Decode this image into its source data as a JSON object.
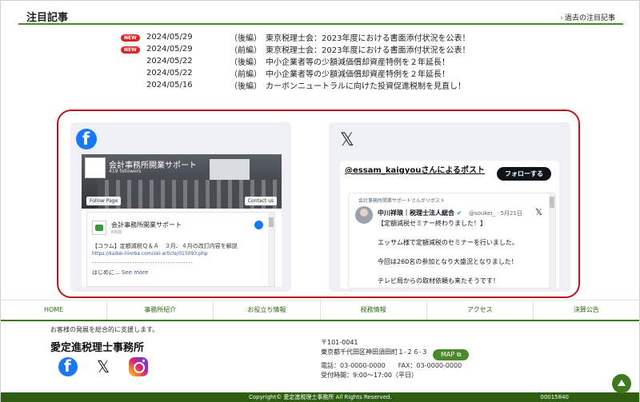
{
  "news": {
    "title": "注目記事",
    "past_link": "過去の注目記事",
    "badge_label": "NEW",
    "items": [
      {
        "new": true,
        "date": "2024/05/29",
        "text": "（後編）　東京税理士会：2023年度における書面添付状況を公表！"
      },
      {
        "new": true,
        "date": "2024/05/29",
        "text": "（前編）　東京税理士会：2023年度における書面添付状況を公表！"
      },
      {
        "new": false,
        "date": "2024/05/22",
        "text": "（後編）　中小企業者等の少額減価償却資産特例を２年延長！"
      },
      {
        "new": false,
        "date": "2024/05/22",
        "text": "（前編）　中小企業者等の少額減価償却資産特例を２年延長！"
      },
      {
        "new": false,
        "date": "2024/05/16",
        "text": "（後編）　カーボンニュートラルに向けた投資促進税制を見直し！"
      }
    ]
  },
  "facebook": {
    "page_name": "会計事務所開業サポート",
    "followers": "419 followers",
    "follow_label": "Follow Page",
    "contact_label": "Contact us",
    "post_name": "会計事務所開業サポート",
    "post_date": "6日前",
    "post_body": "【コラム】定額減税Ｑ＆Ａ　３月、４月の改訂内容を解説",
    "post_url": "https://kaikei-hiroba.com/zei-article/015093.php",
    "post_dash": "----------------------------------------",
    "post_more_prefix": "はじめに... ",
    "post_more_link": "See more"
  },
  "x": {
    "title": "@essam_kaigyouさんによるポスト",
    "follow_label": "フォローする",
    "repost": "会計事務所開業サポートさんがリポスト",
    "author": "中川祥琅｜税理士法人総合",
    "handle": "@soukei_ · 5月21日",
    "line1": "【定額減税セミナー終わりました！】",
    "line2": "エッサム様で定額減税のセミナーを行いました。",
    "line3": "今回は260名の参加となり大盛況となりました！",
    "line4": "テレビ局からの取材依頼も来たそうです！"
  },
  "nav": [
    "HOME",
    "事務所紹介",
    "お役立ち情報",
    "税務情報",
    "アクセス",
    "決算公告"
  ],
  "footer": {
    "tagline": "お客様の発展を総合的に支援します。",
    "firm": "愛定進税理士事務所",
    "zip": "〒101-0041",
    "address": "東京都千代田区神田須田町１-２６-３",
    "map_label": "MAP",
    "phone": "電話：03-0000-0000　　FAX：03-0000-0000",
    "hours": "受付時間：9:00～17:00（平日）",
    "copyright": "Copyright© 愛定進税理士事務所 All Rights Reserved.",
    "counter": "00015840"
  }
}
